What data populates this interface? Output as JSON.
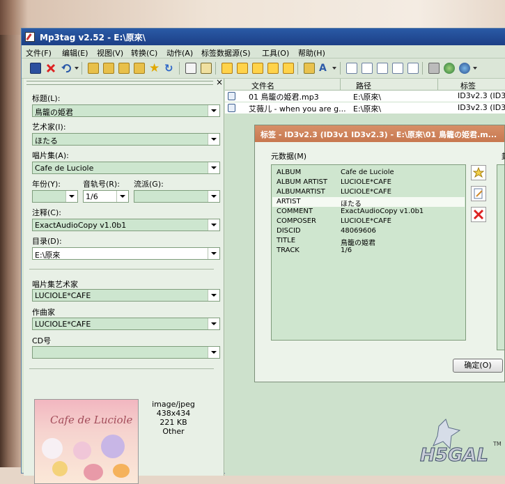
{
  "window": {
    "title": "Mp3tag v2.52  -  E:\\原來\\"
  },
  "menu": [
    "文件(F)",
    "编辑(E)",
    "视图(V)",
    "转换(C)",
    "动作(A)",
    "标签数据源(S)",
    "工具(O)",
    "帮助(H)"
  ],
  "toolbar": {
    "icons": [
      "save-icon",
      "delete-icon",
      "undo-icon",
      "change-dir-icon",
      "add-dir-icon",
      "folder-open-icon",
      "folder-sub-icon",
      "favorite-star-icon",
      "refresh-icon",
      "copy-tag-icon",
      "paste-tag-icon",
      "convert-tag-filename-icon",
      "convert-filename-tag-icon",
      "convert-text-tag-icon",
      "convert-tag-tag-icon",
      "autonumber-icon",
      "actions-icon",
      "case-conversion-icon",
      "edit-icon",
      "export-icon",
      "playlist-icon",
      "quick-action-icon",
      "number-icon",
      "freedb-icon",
      "amazon-icon",
      "discogs-icon"
    ]
  },
  "left_panel": {
    "fields": {
      "title": {
        "label": "标题(L):",
        "value": "鳥籠の姫君"
      },
      "artist": {
        "label": "艺术家(I):",
        "value": "ほたる"
      },
      "album": {
        "label": "唱片集(A):",
        "value": "Cafe de Luciole"
      },
      "year": {
        "label": "年份(Y):",
        "value": ""
      },
      "track": {
        "label": "音轨号(R):",
        "value": "1/6"
      },
      "genre": {
        "label": "流派(G):",
        "value": ""
      },
      "comment": {
        "label": "注释(C):",
        "value": "ExactAudioCopy v1.0b1"
      },
      "directory": {
        "label": "目录(D):",
        "value": "E:\\原來"
      },
      "album_artist": {
        "label": "唱片集艺术家",
        "value": "LUCIOLE*CAFE"
      },
      "composer": {
        "label": "作曲家",
        "value": "LUCIOLE*CAFE"
      },
      "disc": {
        "label": "CD号",
        "value": ""
      }
    },
    "cover": {
      "art_text": "Cafe de Luciole",
      "mime": "image/jpeg",
      "dimensions": "438x434",
      "size": "221 KB",
      "type": "Other"
    }
  },
  "file_list": {
    "columns": [
      "文件名",
      "路径",
      "标签"
    ],
    "rows": [
      {
        "filename": "01 鳥籠の姫君.mp3",
        "path": "E:\\原來\\",
        "tag": "ID3v2.3 (ID3"
      },
      {
        "filename": "艾薇儿 - when you are g...",
        "path": "E:\\原來\\",
        "tag": "ID3v2.3 (ID3v"
      }
    ]
  },
  "dialog": {
    "title": "标签 - ID3v2.3 (ID3v1 ID3v2.3) - E:\\原來\\01 鳥籠の姫君.m...",
    "metadata_label": "元数据(M)",
    "partial_label": "封",
    "metadata": [
      {
        "key": "ALBUM",
        "value": "Cafe de Luciole"
      },
      {
        "key": "ALBUM ARTIST",
        "value": "LUCIOLE*CAFE"
      },
      {
        "key": "ALBUMARTIST",
        "value": "LUCIOLE*CAFE"
      },
      {
        "key": "ARTIST",
        "value": "ほたる"
      },
      {
        "key": "COMMENT",
        "value": "ExactAudioCopy v1.0b1"
      },
      {
        "key": "COMPOSER",
        "value": "LUCIOLE*CAFE"
      },
      {
        "key": "DISCID",
        "value": "48069606"
      },
      {
        "key": "TITLE",
        "value": "鳥籠の姫君"
      },
      {
        "key": "TRACK",
        "value": "1/6"
      }
    ],
    "selected_index": 3,
    "ok_label": "确定(O)"
  },
  "watermark": {
    "text": "H5GAL",
    "tm": "TM"
  }
}
